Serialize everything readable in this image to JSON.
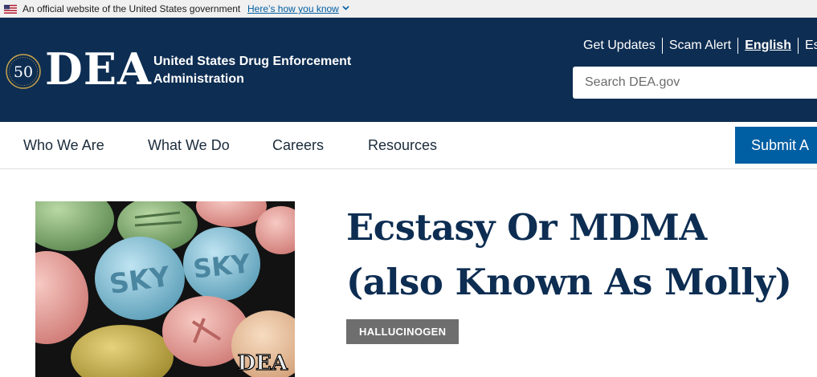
{
  "gov_banner": {
    "text": "An official website of the United States government",
    "link": "Here’s how you know"
  },
  "header": {
    "logo_text": "DEA",
    "agency_name": "United States Drug Enforcement Administration",
    "seal_text": "50",
    "top_links": [
      "Get Updates",
      "Scam Alert",
      "English",
      "Es"
    ],
    "search_placeholder": "Search DEA.gov"
  },
  "nav": {
    "items": [
      "Who We Are",
      "What We Do",
      "Careers",
      "Resources"
    ],
    "submit_label": "Submit A"
  },
  "main": {
    "photo_watermark": "DEA",
    "pill_texts": [
      "SKY",
      "SKY"
    ],
    "title": "Ecstasy Or MDMA (also Known As Molly)",
    "tag": "HALLUCINOGEN"
  },
  "colors": {
    "header_bg": "#0d2d52",
    "accent": "#005ea2",
    "title": "#0d2d52",
    "tag_bg": "#6e6e6e"
  }
}
